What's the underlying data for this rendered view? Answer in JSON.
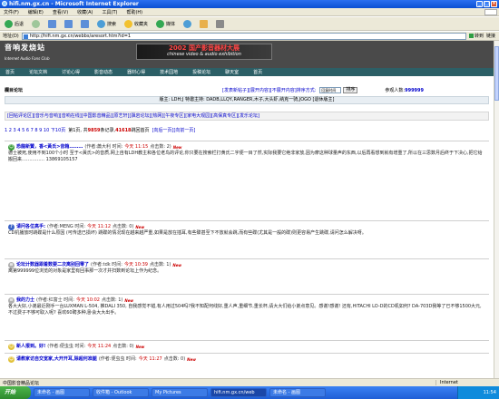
{
  "window": {
    "title": "hifi.nm.gx.cn - Microsoft Internet Explorer"
  },
  "menu": [
    "文件(F)",
    "编辑(E)",
    "查看(V)",
    "收藏(A)",
    "工具(T)",
    "帮助(H)"
  ],
  "toolbar": {
    "back": "后退",
    "search": "搜索",
    "favorites": "收藏夹",
    "media": "媒体"
  },
  "address": {
    "label": "地址(D)",
    "url": "http://hifi.nm.gx.cn/webbs/aresort.htm?id=1",
    "go": "转到",
    "links": "链接"
  },
  "site": {
    "logo_cn": "音响发烧站",
    "logo_en": "Internet Audio Fans Club",
    "banner_cn": "2002 国产影音器材大展",
    "banner_en": "chinese video & audio exhibition",
    "nav": [
      "首页",
      "论坛文档",
      "讨论心得",
      "影音动态",
      "器材心得",
      "技术园地",
      "投稿论坛",
      "聊天室",
      "首页"
    ]
  },
  "forum": {
    "name": "欄目论坛",
    "post_links": "[发表新帖子][展开内容][不展开内容]排序方式:",
    "sort_value": "回复时间",
    "sort_button": "排序",
    "online": "参观人数:",
    "online_count": "999999",
    "moderators": "版主: LDH;J 特邀主持: DADB,LLQY,RANGER,木子,大头虾,纳克一骑,JOGO [退休版主]",
    "related": "[回帖评论区][音乐与音响][音响在线][中国影音精品][原艺轩][飘岩论坛][热网][午夜专区][家电大观园][高保真专区][发乐论坛]"
  },
  "pager": {
    "pages": "1 2 3 4 5 6 7 8 9 10 下10页",
    "info_prefix": "第1页, 共",
    "total_posts": "9859",
    "info_mid": "条记录,",
    "total_count": "41618",
    "info_suffix": "跳回首页",
    "jump": "[向后一页][向前一页]"
  },
  "posts": [
    {
      "icon": "happy-icon",
      "title": "恐龍新贊，香<黃氏>音箱………",
      "meta": "(作者:蕭大利 时间:",
      "time": "今天 11:15",
      "hits": "点击数: 2)",
      "new": "New",
      "body": "德士被死,使用不到100个小时 至于<黃氏>的音质,网上自有LDH教主和各位老鸟的评论,你只要在搜索栏打黄氏二字便一目了然,实际我要它绝非家放,因为摩这种球量声的东西,以后再看想到就有增重了,所以在三思数月后终于下决心,把它给搬回来…………… 13869105157"
    },
    {
      "icon": "question-icon",
      "title": "请问各位高手:",
      "meta": "(作者:MENG 时间:",
      "time": "今天 11:12",
      "hits": "点击数: 0)",
      "new": "New",
      "body": "CD机播放时跳碟是什么原因 (可传送已损坏) 跳碟的情况现在越来越严重,如果是放在插耳,有些碟甚至下不放就会跳,而有些碟(尤其是一般的碟)则更容易产生跳碟,请问怎么解决呀。"
    },
    {
      "icon": "doc-icon",
      "title": "论坛计数器跟着数要二次离别回零了",
      "meta": "(作者:tdk 时间:",
      "time": "今天 10:39",
      "hits": "点击数: 1)",
      "new": "New",
      "body": "离第999999位浏览的对象是家里有回事那一次才并扫数到论坛上作为纪念。"
    },
    {
      "icon": "doc-icon",
      "title": "我的力士",
      "meta": "(作者:红富士 时间:",
      "time": "今天 10:02",
      "hits": "点击数: 1)",
      "new": "New",
      "body": "各大大好,小弟最近刚手一台LUXMAN L-504, 推DALI 350, 自我感觉不错,有人用过504吗?我不知配何线好,重人声,重细节,重长杯,请大大们给小弟点意见。感谢!感谢! 还有,HITACHI LO-D的CD机如何? DA-703D我等了已不够1500大元,不过费子不够可取入呢? 喜欢60聘多种,卧会大大出手。"
    },
    {
      "icon": "smile-icon",
      "title": "新人报到。好!",
      "meta": "(作者:便虫虫 时间:",
      "time": "今天 11:24",
      "hits": "点击数: 0)",
      "new": "New",
      "body": ""
    },
    {
      "icon": "smile-icon",
      "title": "请教家访自交宽家,大开开耳,除超何准腿",
      "meta": "(作者:便虫虫 时间:",
      "time": "今天 11:27",
      "hits": "点击数: 0)",
      "new": "New",
      "body": ""
    }
  ],
  "status": {
    "done": "中国影音精品论坛",
    "zone": "Internet"
  },
  "taskbar": {
    "start": "开始",
    "tasks": [
      "未命名 - 画图",
      "收件箱 - Outlook",
      "My Pictures",
      "hifi.nm.gx.cn/web",
      "未命名 - 画图"
    ],
    "clock": "11:54"
  }
}
